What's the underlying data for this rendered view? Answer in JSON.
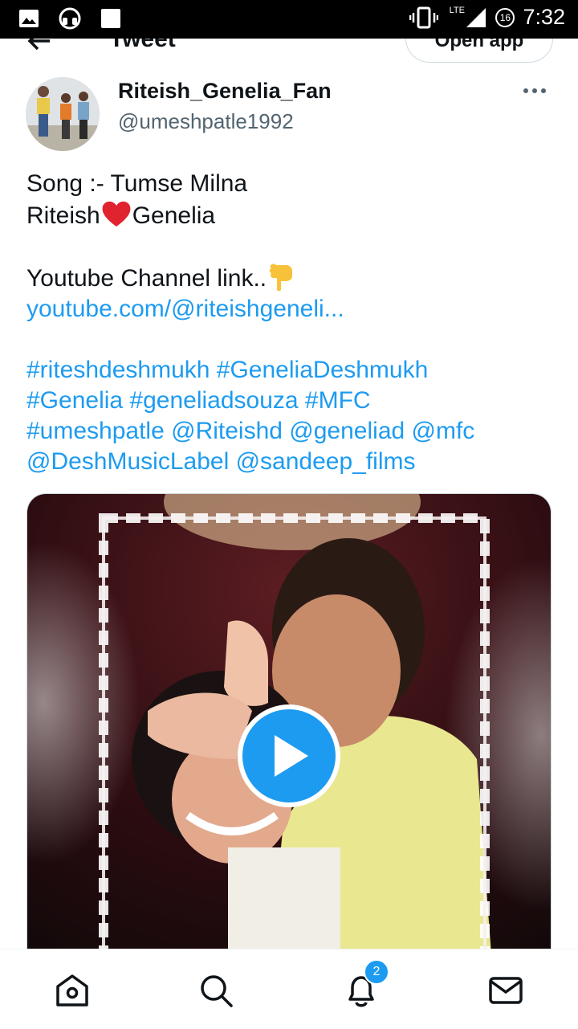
{
  "status_bar": {
    "time": "7:32",
    "network": "LTE",
    "notification_count": "16",
    "icons": [
      "gallery-icon",
      "headset-icon",
      "blank-app-icon",
      "vibrate-icon",
      "signal-icon"
    ]
  },
  "header": {
    "title": "Tweet",
    "open_app_label": "Open app"
  },
  "author": {
    "name": "Riteish_Genelia_Fan",
    "handle": "@umeshpatle1992"
  },
  "tweet": {
    "line1": "Song :- Tumse Milna",
    "line2_prefix": "Riteish",
    "line2_suffix": "Genelia",
    "line3": "Youtube Channel link..",
    "link": "youtube.com/@riteishgeneli...",
    "hashtags_line1": "#riteshdeshmukh #GeneliaDeshmukh",
    "hashtags_line2": "#Genelia #geneliadsouza #MFC",
    "hashtags_line3": "#umeshpatle @Riteishd @geneliad @mfc",
    "hashtags_line4": "@DeshMusicLabel @sandeep_films"
  },
  "media": {
    "type": "video",
    "play_icon": "play-icon"
  },
  "bottom_nav": {
    "items": [
      "home-icon",
      "search-icon",
      "notifications-icon",
      "messages-icon"
    ],
    "notifications_badge": "2"
  },
  "colors": {
    "accent": "#1d9bf0",
    "text": "#0f1419",
    "secondary": "#536471"
  }
}
